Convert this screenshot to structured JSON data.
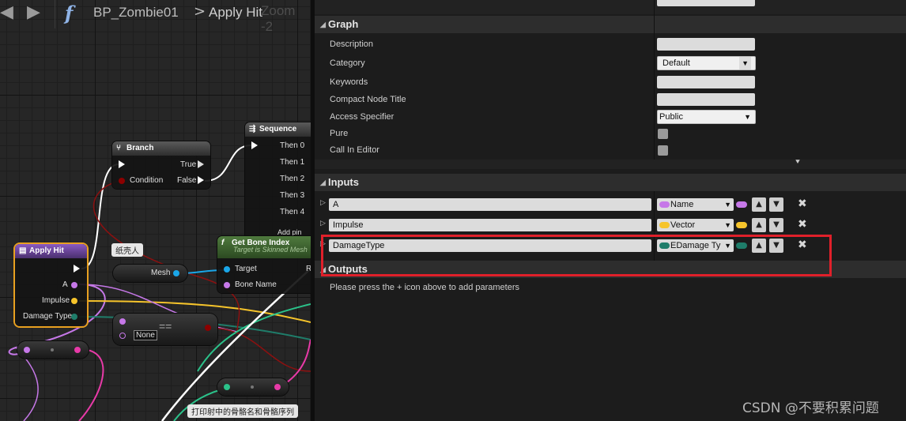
{
  "graph": {
    "breadcrumb": {
      "blueprint": "BP_Zombie01",
      "separator": ">",
      "function": "Apply Hit",
      "zoom": "Zoom -2"
    },
    "nodes": {
      "branch": {
        "title": "Branch",
        "pin_true": "True",
        "pin_condition": "Condition",
        "pin_false": "False"
      },
      "sequence": {
        "title": "Sequence",
        "outputs": [
          "Then 0",
          "Then 1",
          "Then 2",
          "Then 3",
          "Then 4"
        ],
        "add_pin": "Add pin"
      },
      "apply_hit": {
        "title": "Apply Hit",
        "pins": [
          "A",
          "Impulse",
          "Damage Type"
        ]
      },
      "get_bone_index": {
        "title": "Get Bone Index",
        "subtitle": "Target is Skinned Mesh",
        "pin_target": "Target",
        "pin_bone_name": "Bone Name",
        "pin_return": "R"
      },
      "mesh": {
        "label": "Mesh",
        "comment": "纸壳人"
      },
      "equals": {
        "op": "==",
        "value": "None"
      },
      "print_comment": "打印射中的骨骼名和骨骼序列"
    },
    "colors": {
      "exec": "#ffffff",
      "name": "#c678e8",
      "vector": "#f6c42b",
      "enum": "#1f7d6a",
      "bool": "#8c0000",
      "object": "#1aa6e8"
    }
  },
  "details": {
    "graph_section": {
      "title": "Graph",
      "rows": {
        "description": "Description",
        "category": "Category",
        "category_value": "Default",
        "keywords": "Keywords",
        "compact_title": "Compact Node Title",
        "access_specifier": "Access Specifier",
        "access_value": "Public",
        "pure": "Pure",
        "call_in_editor": "Call In Editor"
      }
    },
    "inputs_section": {
      "title": "Inputs",
      "params": [
        {
          "name": "A",
          "type": "Name",
          "color": "#c678e8"
        },
        {
          "name": "Impulse",
          "type": "Vector",
          "color": "#f6c42b"
        },
        {
          "name": "DamageType",
          "type": "EDamage Type",
          "color": "#1f7d6a"
        }
      ]
    },
    "outputs_section": {
      "title": "Outputs",
      "hint": "Please press the + icon above to add parameters"
    }
  },
  "watermark": "CSDN @不要积累问题"
}
